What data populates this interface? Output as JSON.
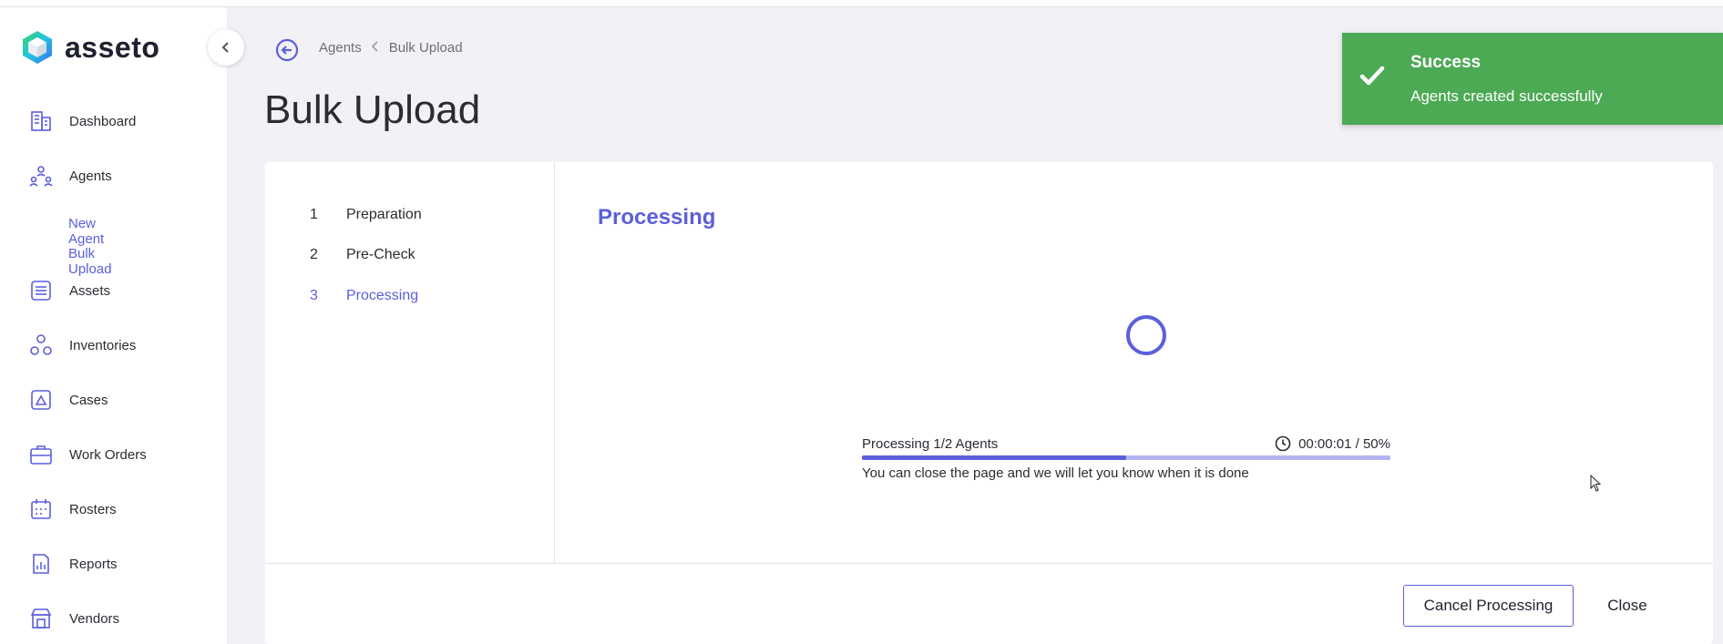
{
  "app": {
    "name": "asseto"
  },
  "sidebar": {
    "items": [
      {
        "label": "Dashboard",
        "icon": "building-icon"
      },
      {
        "label": "Agents",
        "icon": "agents-icon"
      },
      {
        "label": "Assets",
        "icon": "assets-icon"
      },
      {
        "label": "Inventories",
        "icon": "inventories-icon"
      },
      {
        "label": "Cases",
        "icon": "cases-icon"
      },
      {
        "label": "Work Orders",
        "icon": "briefcase-icon"
      },
      {
        "label": "Rosters",
        "icon": "calendar-icon"
      },
      {
        "label": "Reports",
        "icon": "report-icon"
      },
      {
        "label": "Vendors",
        "icon": "store-icon"
      }
    ],
    "agents_sub": [
      "New Agent",
      "Bulk Upload"
    ]
  },
  "breadcrumb": {
    "parent": "Agents",
    "current": "Bulk Upload"
  },
  "page": {
    "title": "Bulk Upload"
  },
  "steps": [
    {
      "num": "1",
      "label": "Preparation"
    },
    {
      "num": "2",
      "label": "Pre-Check"
    },
    {
      "num": "3",
      "label": "Processing"
    }
  ],
  "processing": {
    "title": "Processing",
    "status": "Processing 1/2 Agents",
    "elapsed": "00:00:01 / 50%",
    "progress_percent": 50,
    "note": "You can close the page and we will let you know when it is done"
  },
  "buttons": {
    "cancel": "Cancel Processing",
    "close": "Close"
  },
  "toast": {
    "title": "Success",
    "message": "Agents created successfully",
    "color": "#4caa55"
  },
  "colors": {
    "accent": "#5b5fdb"
  }
}
